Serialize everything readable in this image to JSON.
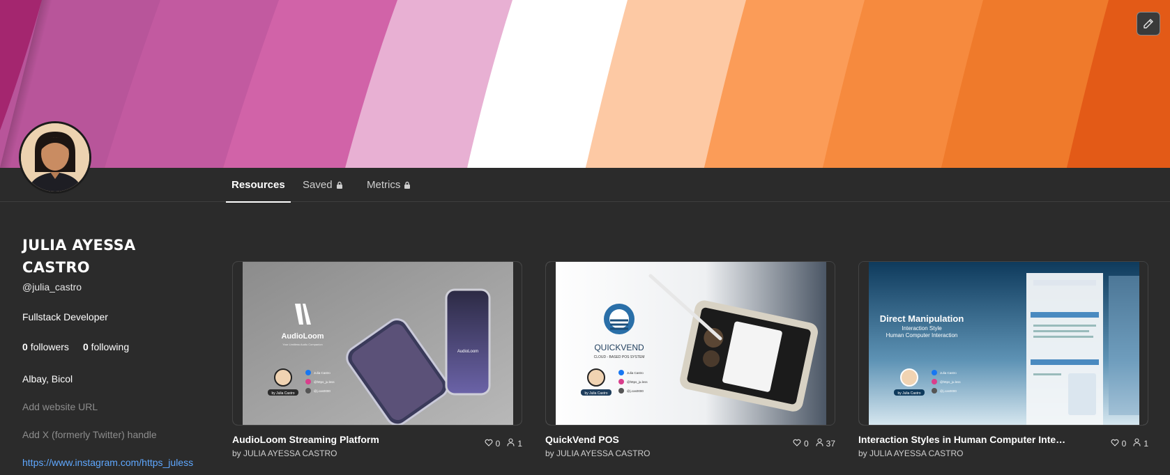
{
  "profile": {
    "name": "JULIA AYESSA CASTRO",
    "handle": "@julia_castro",
    "bio": "Fullstack Developer",
    "followers_count": "0",
    "followers_label": "followers",
    "following_count": "0",
    "following_label": "following",
    "location": "Albay, Bicol",
    "website_placeholder": "Add website URL",
    "twitter_placeholder": "Add X (formerly Twitter) handle",
    "instagram_url": "https://www.instagram.com/https_juless"
  },
  "tabs": [
    {
      "label": "Resources",
      "active": true,
      "locked": false
    },
    {
      "label": "Saved",
      "active": false,
      "locked": true
    },
    {
      "label": "Metrics",
      "active": false,
      "locked": true
    }
  ],
  "cards": [
    {
      "title": "AudioLoom Streaming Platform",
      "author": "by JULIA AYESSA CASTRO",
      "likes": "0",
      "users": "1",
      "thumb": {
        "brand": "AudioLoom",
        "tagline": "Your Limitless Audio Companion",
        "byline": "by Julia Castro",
        "social": [
          "Julia Castro",
          "@https_ju.less",
          "@j.cas0000"
        ]
      }
    },
    {
      "title": "QuickVend POS",
      "author": "by JULIA AYESSA CASTRO",
      "likes": "0",
      "users": "37",
      "thumb": {
        "brand": "QUICKVEND",
        "tagline": "CLOUD - BASED POS SYSTEM",
        "byline": "by Julia Castro",
        "social": [
          "Julia Castro",
          "@https_ju.less",
          "@j.cas0000"
        ]
      }
    },
    {
      "title": "Interaction Styles in Human Computer Interaction...",
      "author": "by JULIA AYESSA CASTRO",
      "likes": "0",
      "users": "1",
      "thumb": {
        "brand": "Direct Manipulation",
        "tagline": "Interaction Style",
        "tagline2": "Human Computer Interaction",
        "byline": "by Julia Castro",
        "social": [
          "Julia Castro",
          "@https_ju.less",
          "@j.cas0000"
        ]
      }
    }
  ],
  "colors": {
    "background": "#2b2b2b",
    "link": "#5fa8ff",
    "muted": "#8d8d8d"
  },
  "icons": [
    "pencil-icon",
    "lock-icon",
    "heart-icon",
    "user-icon",
    "facebook-icon",
    "instagram-icon",
    "github-icon"
  ]
}
